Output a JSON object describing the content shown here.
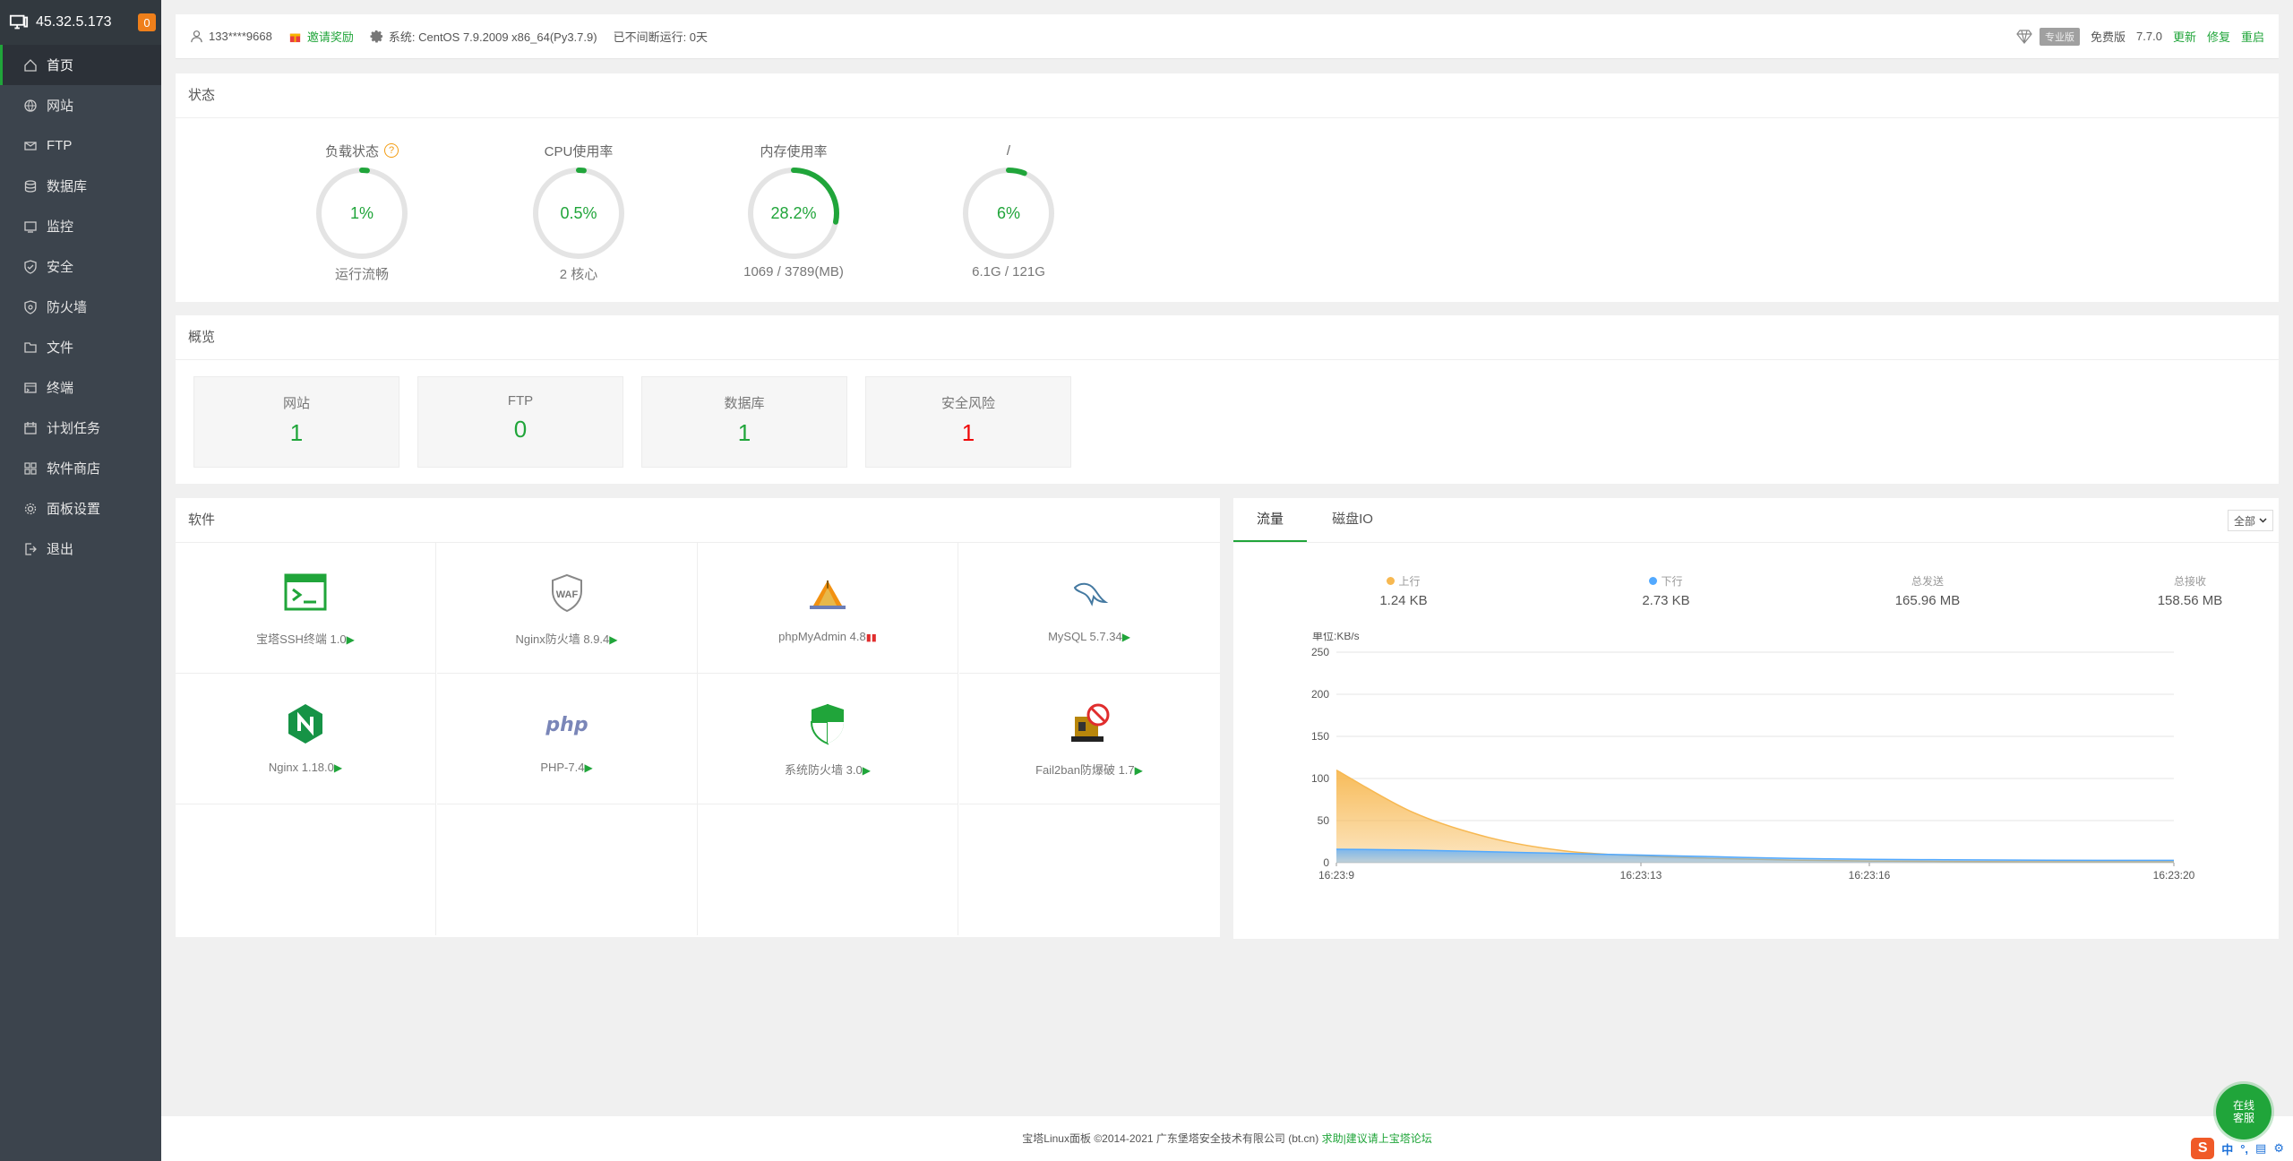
{
  "sidebar": {
    "ip": "45.32.5.173",
    "badge": "0",
    "items": [
      {
        "label": "首页",
        "icon": "home-icon"
      },
      {
        "label": "网站",
        "icon": "globe-icon"
      },
      {
        "label": "FTP",
        "icon": "ftp-icon"
      },
      {
        "label": "数据库",
        "icon": "database-icon"
      },
      {
        "label": "监控",
        "icon": "monitor-icon"
      },
      {
        "label": "安全",
        "icon": "shield-check-icon"
      },
      {
        "label": "防火墙",
        "icon": "firewall-icon"
      },
      {
        "label": "文件",
        "icon": "folder-icon"
      },
      {
        "label": "终端",
        "icon": "terminal-icon"
      },
      {
        "label": "计划任务",
        "icon": "calendar-icon"
      },
      {
        "label": "软件商店",
        "icon": "apps-icon"
      },
      {
        "label": "面板设置",
        "icon": "gear-icon"
      },
      {
        "label": "退出",
        "icon": "logout-icon"
      }
    ]
  },
  "topbar": {
    "user": "133****9668",
    "invite": "邀请奖励",
    "system": "系统:  CentOS 7.9.2009 x86_64(Py3.7.9)",
    "uptime": "已不间断运行: 0天",
    "pro_tag": "专业版",
    "edition": "免费版",
    "version": "7.7.0",
    "update": "更新",
    "repair": "修复",
    "restart": "重启"
  },
  "status": {
    "title": "状态",
    "gauges": [
      {
        "label": "负载状态",
        "value": "1%",
        "percent": 1,
        "sub": "运行流畅",
        "help": "?"
      },
      {
        "label": "CPU使用率",
        "value": "0.5%",
        "percent": 0.5,
        "sub": "2 核心"
      },
      {
        "label": "内存使用率",
        "value": "28.2%",
        "percent": 28.2,
        "sub": "1069 / 3789(MB)"
      },
      {
        "label": "/",
        "value": "6%",
        "percent": 6,
        "sub": "6.1G / 121G"
      }
    ]
  },
  "overview": {
    "title": "概览",
    "cards": [
      {
        "label": "网站",
        "value": "1"
      },
      {
        "label": "FTP",
        "value": "0"
      },
      {
        "label": "数据库",
        "value": "1"
      },
      {
        "label": "安全风险",
        "value": "1"
      }
    ]
  },
  "software": {
    "title": "软件",
    "items": [
      {
        "name": "宝塔SSH终端 1.0",
        "icon": "ssh-terminal-icon",
        "state": "▶"
      },
      {
        "name": "Nginx防火墙 8.9.4",
        "icon": "waf-shield-icon",
        "state": "▶"
      },
      {
        "name": "phpMyAdmin 4.8",
        "icon": "phpmyadmin-icon",
        "state": "▮▮"
      },
      {
        "name": "MySQL 5.7.34",
        "icon": "mysql-dolphin-icon",
        "state": "▶"
      },
      {
        "name": "Nginx 1.18.0",
        "icon": "nginx-icon",
        "state": "▶"
      },
      {
        "name": "PHP-7.4",
        "icon": "php-icon",
        "state": "▶"
      },
      {
        "name": "系统防火墙 3.0",
        "icon": "system-firewall-icon",
        "state": "▶"
      },
      {
        "name": "Fail2ban防爆破 1.7",
        "icon": "fail2ban-icon",
        "state": "▶"
      }
    ]
  },
  "flow": {
    "tabs": [
      "流量",
      "磁盘IO"
    ],
    "select": "全部",
    "stats": [
      {
        "label": "上行",
        "value": "1.24 KB",
        "color": "#f7b851"
      },
      {
        "label": "下行",
        "value": "2.73 KB",
        "color": "#52a9ff"
      },
      {
        "label": "总发送",
        "value": "165.96 MB"
      },
      {
        "label": "总接收",
        "value": "158.56 MB"
      }
    ]
  },
  "chart_data": {
    "type": "area",
    "ylabel": "单位:KB/s",
    "ylim": [
      0,
      250
    ],
    "yticks": [
      0,
      50,
      100,
      150,
      200,
      250
    ],
    "x": [
      "16:23:9",
      "16:23:10",
      "16:23:11",
      "16:23:12",
      "16:23:13",
      "16:23:14",
      "16:23:15",
      "16:23:16",
      "16:23:17",
      "16:23:18",
      "16:23:19",
      "16:23:20"
    ],
    "xticks": [
      "16:23:9",
      "16:23:13",
      "16:23:16",
      "16:23:20"
    ],
    "series": [
      {
        "name": "上行",
        "color": "#f7b851",
        "values": [
          110,
          60,
          30,
          14,
          8,
          5,
          3,
          2,
          1.5,
          1.2,
          1.2,
          1.24
        ]
      },
      {
        "name": "下行",
        "color": "#52a9ff",
        "values": [
          16,
          15,
          13,
          11,
          9,
          7,
          5,
          4,
          3.5,
          3,
          2.8,
          2.73
        ]
      }
    ],
    "grid": true
  },
  "footer": {
    "copyright": "宝塔Linux面板 ©2014-2021 广东堡塔安全技术有限公司 (bt.cn)",
    "forum": "求助|建议请上宝塔论坛"
  },
  "service": {
    "line1": "在线",
    "line2": "客服"
  },
  "ime": {
    "logo": "S",
    "lang": "中"
  }
}
